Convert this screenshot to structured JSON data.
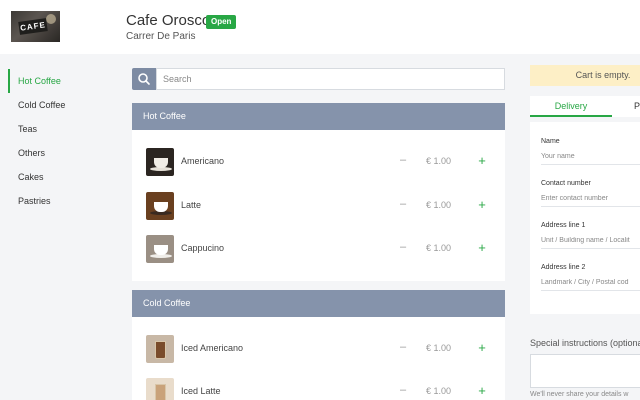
{
  "shop": {
    "name": "Cafe Orosco",
    "status": "Open",
    "address": "Carrer De Paris",
    "logo_text": "CAFE"
  },
  "sidebar": {
    "items": [
      {
        "label": "Hot Coffee",
        "active": true
      },
      {
        "label": "Cold Coffee"
      },
      {
        "label": "Teas"
      },
      {
        "label": "Others"
      },
      {
        "label": "Cakes"
      },
      {
        "label": "Pastries"
      }
    ]
  },
  "search": {
    "placeholder": "Search",
    "icon": "search-icon"
  },
  "menu": {
    "hot": {
      "title": "Hot Coffee",
      "items": [
        {
          "name": "Americano",
          "price": "€ 1.00",
          "minus": "–",
          "plus": "+"
        },
        {
          "name": "Latte",
          "price": "€ 1.00",
          "minus": "–",
          "plus": "+"
        },
        {
          "name": "Cappucino",
          "price": "€ 1.00",
          "minus": "–",
          "plus": "+"
        }
      ]
    },
    "cold": {
      "title": "Cold Coffee",
      "items": [
        {
          "name": "Iced Americano",
          "price": "€ 1.00",
          "minus": "–",
          "plus": "+"
        },
        {
          "name": "Iced Latte",
          "price": "€ 1.00",
          "minus": "–",
          "plus": "+"
        }
      ]
    }
  },
  "cart": {
    "empty_text": "Cart is empty."
  },
  "order_tabs": {
    "delivery": "Delivery",
    "pickup": "P"
  },
  "form": {
    "name_label": "Name",
    "name_placeholder": "Your name",
    "contact_label": "Contact number",
    "contact_placeholder": "Enter contact number",
    "address1_label": "Address line 1",
    "address1_placeholder": "Unit / Building name / Localit",
    "address2_label": "Address line 2",
    "address2_placeholder": "Landmark / City / Postal cod"
  },
  "special": {
    "label": "Special instructions (optiona",
    "note": "We'll never share your details w"
  },
  "colors": {
    "accent": "#28a745",
    "category_bar": "#8593ab",
    "cart_notice": "#fdefc6"
  }
}
